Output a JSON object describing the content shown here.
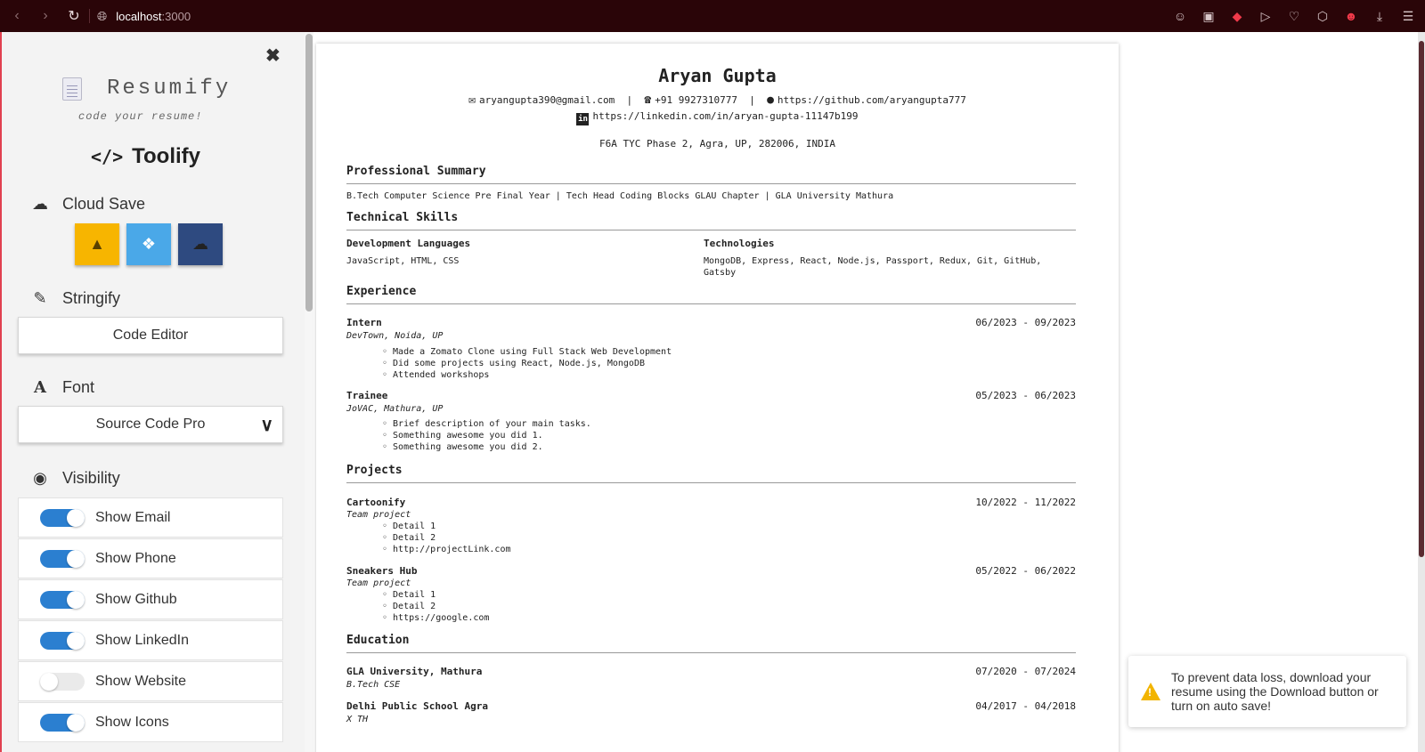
{
  "browser": {
    "url_host": "localhost",
    "url_port": ":3000"
  },
  "sidebar": {
    "brand_name": "Resumify",
    "tagline": "code your resume!",
    "toolify_label": "Toolify",
    "cloud_save_label": "Cloud Save",
    "stringify_label": "Stringify",
    "code_editor_label": "Code Editor",
    "font_label": "Font",
    "font_selected": "Source Code Pro",
    "visibility_label": "Visibility",
    "toggles": [
      {
        "label": "Show Email",
        "on": true
      },
      {
        "label": "Show Phone",
        "on": true
      },
      {
        "label": "Show Github",
        "on": true
      },
      {
        "label": "Show LinkedIn",
        "on": true
      },
      {
        "label": "Show Website",
        "on": false
      },
      {
        "label": "Show Icons",
        "on": true
      }
    ]
  },
  "resume": {
    "name": "Aryan Gupta",
    "email": "aryangupta390@gmail.com",
    "phone": "+91 9927310777",
    "github": "https://github.com/aryangupta777",
    "linkedin": "https://linkedin.com/in/aryan-gupta-11147b199",
    "address": "F6A TYC Phase 2, Agra, UP, 282006, INDIA",
    "summary_title": "Professional Summary",
    "summary": "B.Tech Computer Science Pre Final Year | Tech Head Coding Blocks GLAU Chapter | GLA University Mathura",
    "skills_title": "Technical Skills",
    "skills": [
      {
        "heading": "Development Languages",
        "value": "JavaScript, HTML, CSS"
      },
      {
        "heading": "Technologies",
        "value": "MongoDB, Express, React, Node.js, Passport, Redux, Git, GitHub,",
        "value2": "Gatsby"
      }
    ],
    "experience_title": "Experience",
    "experience": [
      {
        "role": "Intern",
        "org": "DevTown, Noida, UP",
        "dates": "06/2023 - 09/2023",
        "points": [
          "Made a Zomato Clone using Full Stack Web Development",
          "Did some projects using React, Node.js, MongoDB",
          "Attended workshops"
        ]
      },
      {
        "role": "Trainee",
        "org": "JoVAC, Mathura, UP",
        "dates": "05/2023 - 06/2023",
        "points": [
          "Brief description of your main tasks.",
          "Something awesome you did 1.",
          "Something awesome you did 2."
        ]
      }
    ],
    "projects_title": "Projects",
    "projects": [
      {
        "name": "Cartoonify",
        "type": "Team project",
        "dates": "10/2022 - 11/2022",
        "points": [
          "Detail 1",
          "Detail 2",
          "http://projectLink.com"
        ]
      },
      {
        "name": "Sneakers Hub",
        "type": "Team project",
        "dates": "05/2022 - 06/2022",
        "points": [
          "Detail 1",
          "Detail 2",
          "https://google.com"
        ]
      }
    ],
    "education_title": "Education",
    "education": [
      {
        "school": "GLA University, Mathura",
        "degree": "B.Tech CSE",
        "dates": "07/2020 - 07/2024"
      },
      {
        "school": "Delhi Public School Agra",
        "degree": "X TH",
        "dates": "04/2017 - 04/2018"
      }
    ]
  },
  "toast": {
    "message": "To prevent data loss, download your resume using the Download button or turn on auto save!"
  },
  "colors": {
    "chrome_bg": "#2a0508",
    "toggle_on": "#2b7fd0",
    "gdrive": "#f7b500",
    "dropbox": "#4aa8e8",
    "cloud": "#2e4a80",
    "warning": "#f2b400"
  }
}
